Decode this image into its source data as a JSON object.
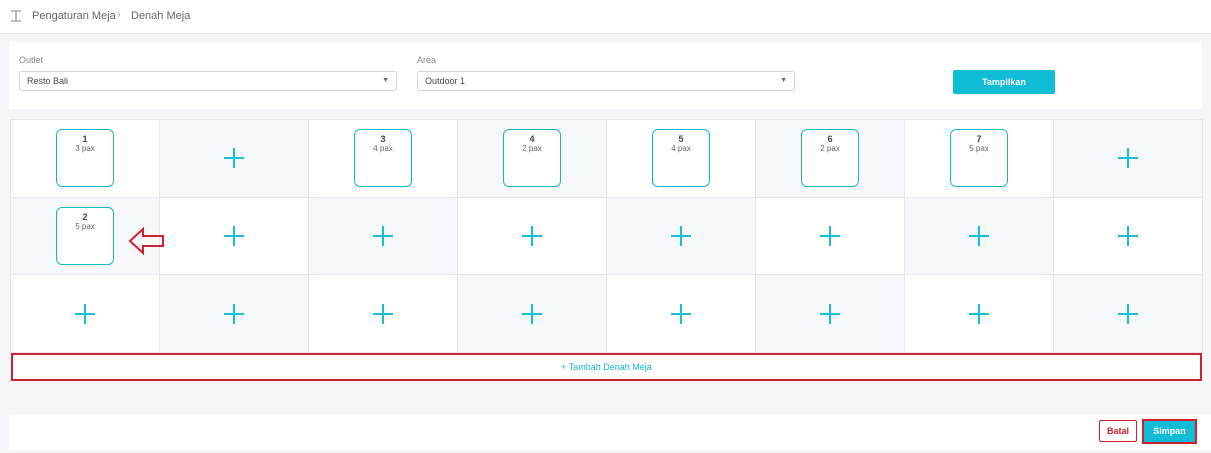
{
  "breadcrumb": {
    "parent": "Pengaturan Meja",
    "current": "Denah Meja"
  },
  "filters": {
    "outlet_label": "Outlet",
    "outlet_value": "Resto Bali",
    "area_label": "Area",
    "area_value": "Outdoor 1",
    "show_button": "Tampilkan"
  },
  "grid": {
    "rows": [
      [
        {
          "table": "1",
          "pax": "3 pax"
        },
        null,
        {
          "table": "3",
          "pax": "4 pax"
        },
        {
          "table": "4",
          "pax": "2 pax"
        },
        {
          "table": "5",
          "pax": "4 pax"
        },
        {
          "table": "6",
          "pax": "2 pax"
        },
        {
          "table": "7",
          "pax": "5 pax"
        },
        null
      ],
      [
        {
          "table": "2",
          "pax": "5 pax"
        },
        null,
        null,
        null,
        null,
        null,
        null,
        null
      ],
      [
        null,
        null,
        null,
        null,
        null,
        null,
        null,
        null
      ]
    ]
  },
  "add_row_label": "+ Tambah Denah Meja",
  "actions": {
    "cancel": "Batal",
    "save": "Simpan"
  },
  "colors": {
    "accent": "#11bcd6",
    "highlight": "#cc2231"
  },
  "icons": {
    "breadcrumb": "layout-icon",
    "empty_slot": "plus-icon",
    "annotation": "arrow-left-icon"
  }
}
